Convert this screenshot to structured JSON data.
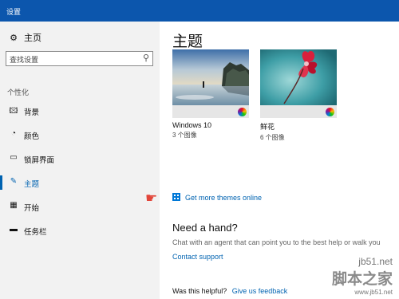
{
  "window": {
    "title": "设置"
  },
  "sidebar": {
    "home_label": "主页",
    "search_placeholder": "查找设置",
    "section_label": "个性化",
    "items": [
      {
        "label": "背景"
      },
      {
        "label": "颜色"
      },
      {
        "label": "锁屏界面"
      },
      {
        "label": "主题"
      },
      {
        "label": "开始"
      },
      {
        "label": "任务栏"
      }
    ]
  },
  "main": {
    "title": "主题",
    "themes": [
      {
        "name": "Windows 10",
        "count": "3 个图像"
      },
      {
        "name": "鲜花",
        "count": "6 个图像"
      }
    ],
    "store_link": "Get more themes online",
    "help_title": "Need a hand?",
    "help_desc": "Chat with an agent that can point you to the best help or walk you",
    "contact_link": "Contact support",
    "helpful_q": "Was this helpful?",
    "feedback_link": "Give us feedback"
  },
  "watermark": {
    "site": "jb51.net",
    "brand": "脚本之家",
    "url": "www.jb51.net"
  },
  "colors": {
    "accent": "#0063b1",
    "titlebar": "#0c56ad"
  }
}
